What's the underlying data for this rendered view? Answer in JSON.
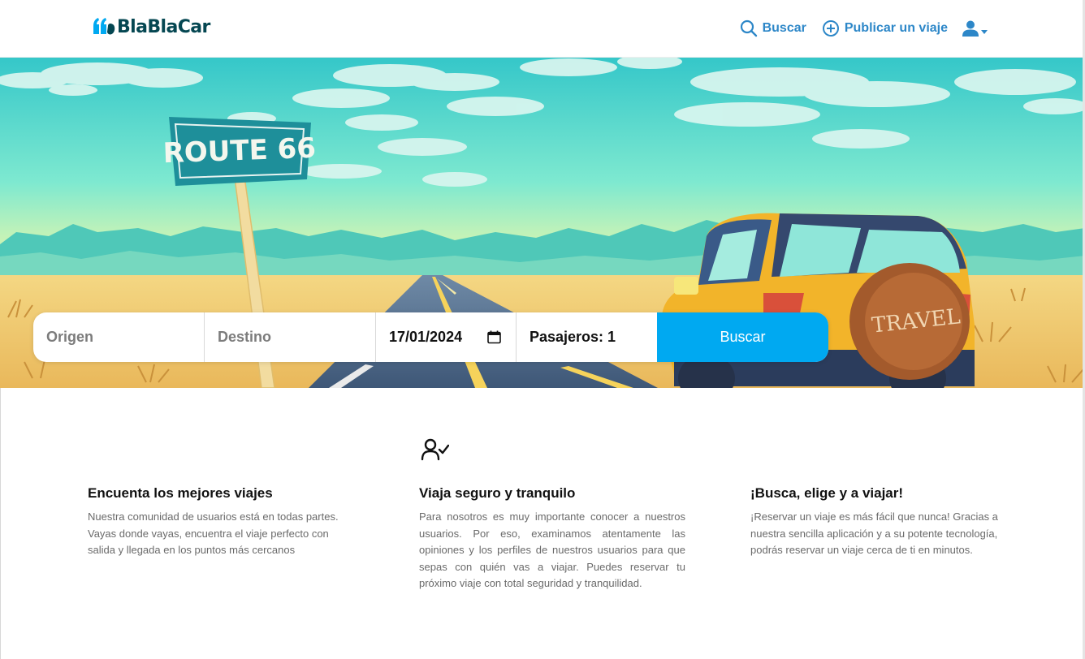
{
  "header": {
    "brand": "BlaBlaCar",
    "nav": {
      "search_label": "Buscar",
      "publish_label": "Publicar un viaje"
    },
    "icons": [
      "search-icon",
      "plus-circle-icon",
      "user-icon",
      "caret-down-icon"
    ]
  },
  "hero": {
    "sign_text": "ROUTE 66",
    "tire_text": "TRAVEL"
  },
  "search": {
    "origin_placeholder": "Origen",
    "destination_placeholder": "Destino",
    "date_value": "17/01/2024",
    "passengers_label": "Pasajeros: 1",
    "button_label": "Buscar"
  },
  "features": [
    {
      "title": "Encuenta los mejores viajes",
      "text": "Nuestra comunidad de usuarios está en todas partes. Vayas donde vayas, encuentra el viaje perfecto con salida y llegada en los puntos más cercanos"
    },
    {
      "title": "Viaja seguro y tranquilo",
      "text": "Para nosotros es muy importante conocer a nuestros usuarios. Por eso, examinamos atentamente las opiniones y los perfiles de nuestros usuarios para que sepas con quién vas a viajar. Puedes reservar tu próximo viaje con total seguridad y tranquilidad."
    },
    {
      "title": "¡Busca, elige y a viajar!",
      "text": "¡Reservar un viaje es más fácil que nunca! Gracias a nuestra sencilla aplicación y a su potente tecnología, podrás reservar un viaje cerca de ti en minutos."
    }
  ],
  "colors": {
    "brand_dark": "#054752",
    "link_blue": "#2d87c8",
    "button_blue": "#00a9f1",
    "logo_blue": "#00a9f1"
  }
}
